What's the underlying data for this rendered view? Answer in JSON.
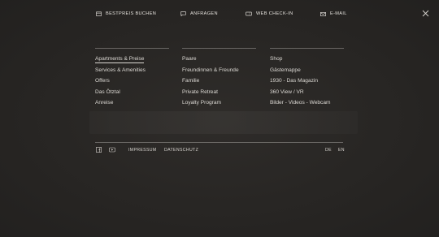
{
  "top": {
    "best_price": "BESTPREIS BUCHEN",
    "inquiry": "ANFRAGEN",
    "checkin": "WEB CHECK-IN",
    "email": "E-MAIL"
  },
  "icons": {
    "calendar": "calendar-icon",
    "chat": "chat-icon",
    "checkin": "ticket-icon",
    "mail": "mail-icon",
    "close": "close-icon",
    "facebook": "facebook-icon",
    "youtube": "youtube-icon"
  },
  "menu": {
    "col1": [
      "Apartments & Preise",
      "Services & Amenities",
      "Offers",
      "Das Ötztal",
      "Anreise"
    ],
    "col2": [
      "Paare",
      "Freundinnen & Freunde",
      "Familie",
      "Private Retreat",
      "Loyalty Program"
    ],
    "col3": [
      "Shop",
      "Gästemappe",
      "1930 - Das Magazin",
      "360 View / VR",
      "Bilder - Videos - Webcam"
    ]
  },
  "footer": {
    "impressum": "IMPRESSUM",
    "datenschutz": "DATENSCHUTZ",
    "lang_de": "DE",
    "lang_en": "EN"
  }
}
